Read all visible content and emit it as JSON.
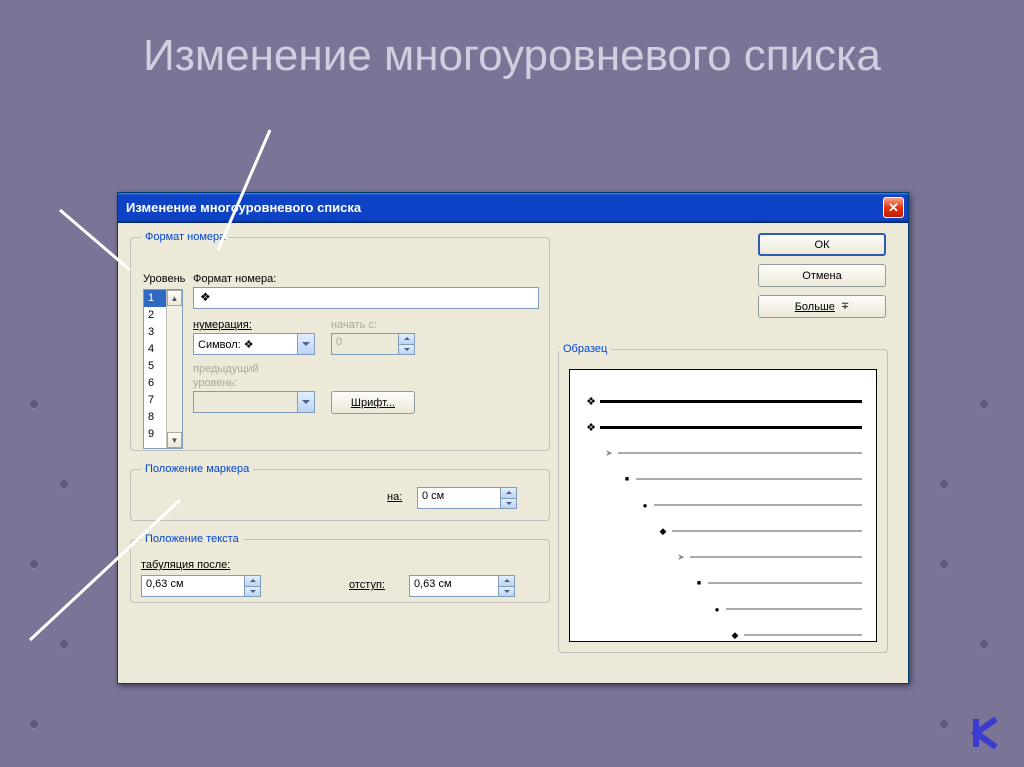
{
  "slide": {
    "title": "Изменение многоуровневого списка"
  },
  "dialog": {
    "title": "Изменение многоуровневого списка",
    "close": "✕",
    "groups": {
      "format": {
        "legend": "Формат номера",
        "level_label": "Уровень",
        "format_label": "Формат номера:",
        "format_value": "❖",
        "levels": [
          "1",
          "2",
          "3",
          "4",
          "5",
          "6",
          "7",
          "8",
          "9"
        ],
        "selected_level": "1",
        "numbering_label": "нумерация:",
        "numbering_value": "Символ: ❖",
        "start_label": "начать с:",
        "start_value": "0",
        "prev_label_1": "предыдущий",
        "prev_label_2": "уровень:",
        "font_btn": "Шрифт..."
      },
      "marker": {
        "legend": "Положение маркера",
        "at_label": "на:",
        "at_value": "0 см"
      },
      "text": {
        "legend": "Положение текста",
        "tab_label": "табуляция после:",
        "tab_value": "0,63 см",
        "indent_label": "отступ:",
        "indent_value": "0,63 см"
      },
      "preview": {
        "legend": "Образец"
      }
    },
    "buttons": {
      "ok": "ОК",
      "cancel": "Отмена",
      "more": "Больше"
    }
  }
}
